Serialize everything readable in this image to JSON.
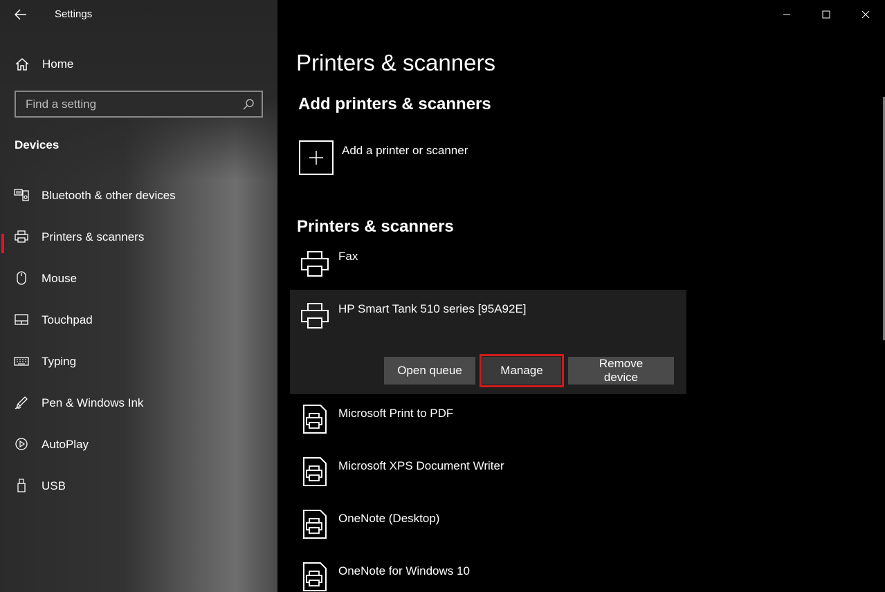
{
  "window": {
    "app_title": "Settings"
  },
  "sidebar": {
    "home_label": "Home",
    "search_placeholder": "Find a setting",
    "section": "Devices",
    "items": [
      {
        "label": "Bluetooth & other devices",
        "icon": "bluetooth-devices-icon",
        "selected": false
      },
      {
        "label": "Printers & scanners",
        "icon": "printer-icon",
        "selected": true
      },
      {
        "label": "Mouse",
        "icon": "mouse-icon",
        "selected": false
      },
      {
        "label": "Touchpad",
        "icon": "touchpad-icon",
        "selected": false
      },
      {
        "label": "Typing",
        "icon": "keyboard-icon",
        "selected": false
      },
      {
        "label": "Pen & Windows Ink",
        "icon": "pen-icon",
        "selected": false
      },
      {
        "label": "AutoPlay",
        "icon": "autoplay-icon",
        "selected": false
      },
      {
        "label": "USB",
        "icon": "usb-icon",
        "selected": false
      }
    ]
  },
  "main": {
    "title": "Printers & scanners",
    "add_section_title": "Add printers & scanners",
    "add_label": "Add a printer or scanner",
    "list_title": "Printers & scanners",
    "devices": [
      {
        "name": "Fax",
        "icon": "printer-icon"
      },
      {
        "name": "HP Smart Tank 510 series [95A92E]",
        "icon": "printer-icon",
        "selected": true
      },
      {
        "name": "Microsoft Print to PDF",
        "icon": "document-printer-icon"
      },
      {
        "name": "Microsoft XPS Document Writer",
        "icon": "document-printer-icon"
      },
      {
        "name": "OneNote (Desktop)",
        "icon": "document-printer-icon"
      },
      {
        "name": "OneNote for Windows 10",
        "icon": "document-printer-icon"
      }
    ],
    "actions": {
      "open_queue": "Open queue",
      "manage": "Manage",
      "remove_device": "Remove device"
    }
  },
  "colors": {
    "accent": "#e81123",
    "highlight_outline": "#d01b1b",
    "button_bg": "#4a4a4a",
    "selected_row_bg": "#1f1f1f"
  }
}
